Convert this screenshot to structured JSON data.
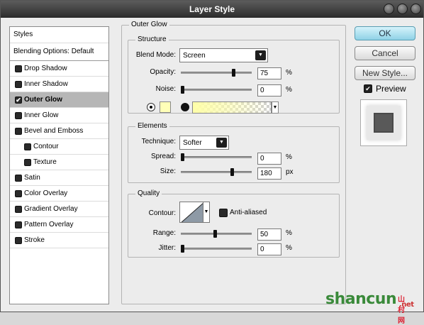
{
  "window": {
    "title": "Layer Style"
  },
  "styles_list": [
    {
      "label": "Styles",
      "type": "header"
    },
    {
      "label": "Blending Options: Default",
      "type": "header"
    },
    {
      "label": "Drop Shadow",
      "checked": false
    },
    {
      "label": "Inner Shadow",
      "checked": false
    },
    {
      "label": "Outer Glow",
      "checked": true,
      "selected": true
    },
    {
      "label": "Inner Glow",
      "checked": false
    },
    {
      "label": "Bevel and Emboss",
      "checked": false
    },
    {
      "label": "Contour",
      "checked": false,
      "indent": true
    },
    {
      "label": "Texture",
      "checked": false,
      "indent": true
    },
    {
      "label": "Satin",
      "checked": false
    },
    {
      "label": "Color Overlay",
      "checked": false
    },
    {
      "label": "Gradient Overlay",
      "checked": false
    },
    {
      "label": "Pattern Overlay",
      "checked": false
    },
    {
      "label": "Stroke",
      "checked": false
    }
  ],
  "outer_glow": {
    "title": "Outer Glow",
    "structure": {
      "title": "Structure",
      "blend_mode_label": "Blend Mode:",
      "blend_mode_value": "Screen",
      "opacity_label": "Opacity:",
      "opacity_value": "75",
      "opacity_unit": "%",
      "opacity_fraction": 0.75,
      "noise_label": "Noise:",
      "noise_value": "0",
      "noise_unit": "%",
      "noise_fraction": 0.0,
      "glow_color": "#ffffb8"
    },
    "elements": {
      "title": "Elements",
      "technique_label": "Technique:",
      "technique_value": "Softer",
      "spread_label": "Spread:",
      "spread_value": "0",
      "spread_unit": "%",
      "spread_fraction": 0.0,
      "size_label": "Size:",
      "size_value": "180",
      "size_unit": "px",
      "size_fraction": 0.72
    },
    "quality": {
      "title": "Quality",
      "contour_label": "Contour:",
      "anti_aliased_label": "Anti-aliased",
      "anti_aliased_checked": false,
      "range_label": "Range:",
      "range_value": "50",
      "range_unit": "%",
      "range_fraction": 0.5,
      "jitter_label": "Jitter:",
      "jitter_value": "0",
      "jitter_unit": "%",
      "jitter_fraction": 0.0
    }
  },
  "buttons": {
    "ok": "OK",
    "cancel": "Cancel",
    "new_style": "New Style...",
    "preview_label": "Preview",
    "preview_checked": true
  },
  "watermark": {
    "text": "shancun",
    "sub": "山村网",
    "net": ".net"
  }
}
